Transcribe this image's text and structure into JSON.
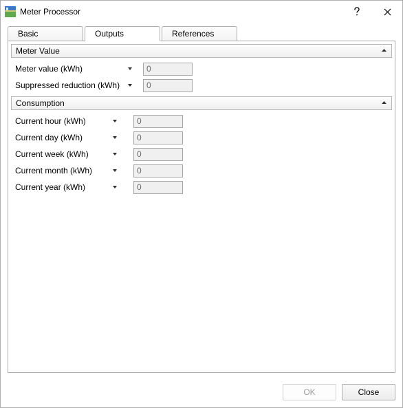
{
  "window": {
    "title": "Meter Processor"
  },
  "tabs": {
    "basic": "Basic",
    "outputs": "Outputs",
    "references": "References"
  },
  "sections": {
    "meter_value": {
      "title": "Meter Value",
      "rows": {
        "meter_value": {
          "label": "Meter value (kWh)",
          "value": "0"
        },
        "suppressed_reduction": {
          "label": "Suppressed reduction (kWh)",
          "value": "0"
        }
      }
    },
    "consumption": {
      "title": "Consumption",
      "rows": {
        "current_hour": {
          "label": "Current hour (kWh)",
          "value": "0"
        },
        "current_day": {
          "label": "Current day (kWh)",
          "value": "0"
        },
        "current_week": {
          "label": "Current week (kWh)",
          "value": "0"
        },
        "current_month": {
          "label": "Current month (kWh)",
          "value": "0"
        },
        "current_year": {
          "label": "Current year (kWh)",
          "value": "0"
        }
      }
    }
  },
  "footer": {
    "ok": "OK",
    "close": "Close"
  },
  "layout": {
    "meter_value_label_w": 148,
    "meter_value_caret_col": 38,
    "consumption_label_w": 118,
    "consumption_caret_col": 54
  }
}
